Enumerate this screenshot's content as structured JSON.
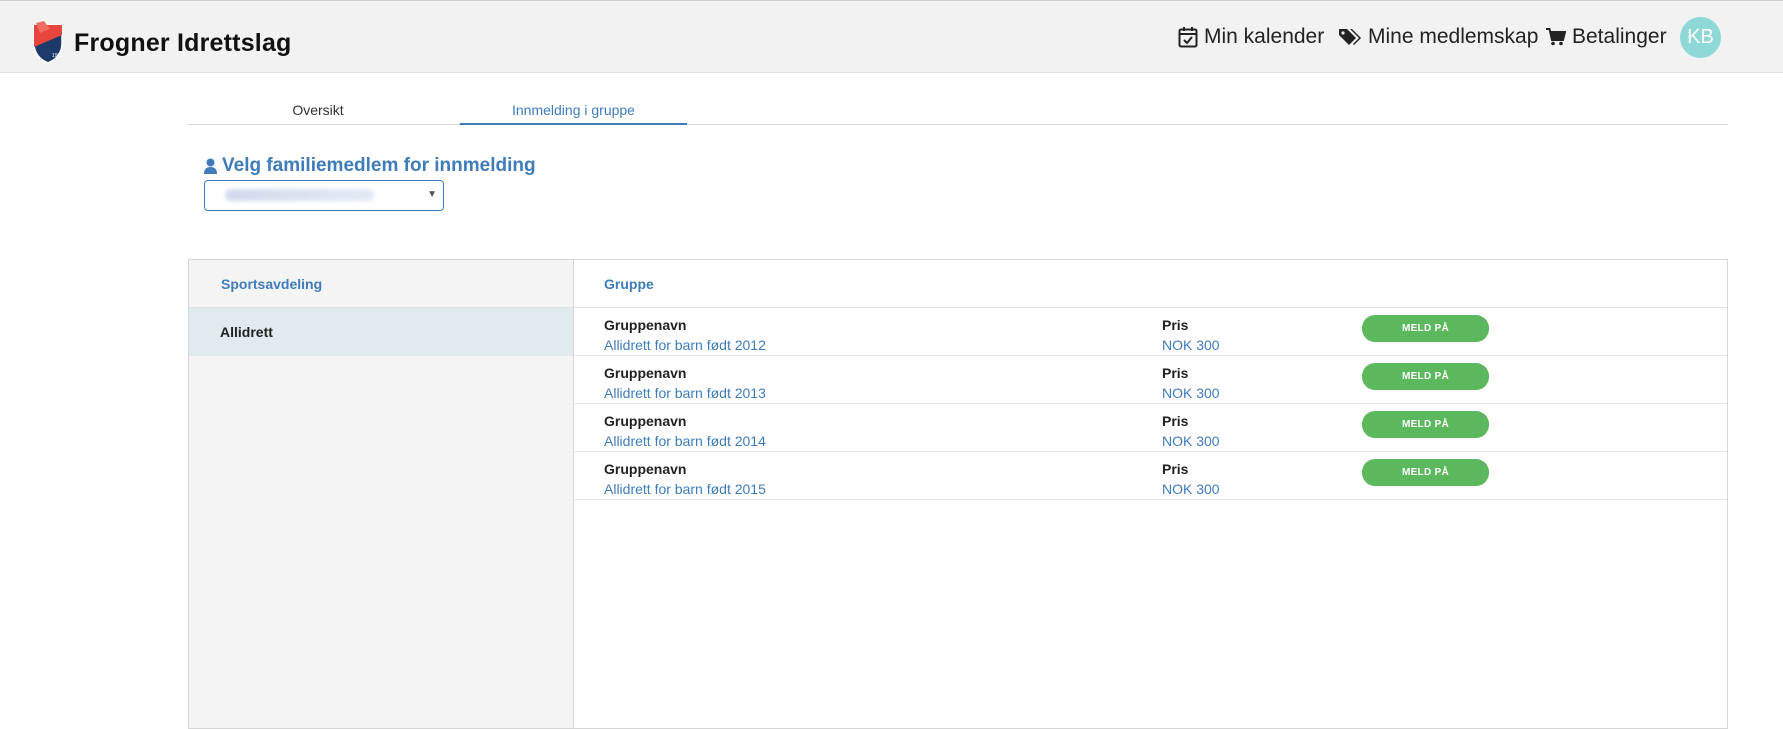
{
  "header": {
    "brand_name": "Frogner Idrettslag",
    "logo_icon": "club-crest",
    "nav": {
      "calendar_label": "Min kalender",
      "memberships_label": "Mine medlemskap",
      "payments_label": "Betalinger"
    },
    "avatar_initials": "KB",
    "avatar_color": "#8fd8d8"
  },
  "tabs": [
    {
      "label": "Oversikt",
      "active": false
    },
    {
      "label": "Innmelding i gruppe",
      "active": true
    }
  ],
  "family": {
    "title": "Velg familiemedlem for innmelding",
    "icon": "user-icon",
    "selected_value_hidden": true
  },
  "sidebar": {
    "header": "Sportsavdeling",
    "items": [
      {
        "label": "Allidrett",
        "selected": true
      }
    ]
  },
  "groups": {
    "header": "Gruppe",
    "name_label": "Gruppenavn",
    "price_label": "Pris",
    "button_label": "MELD PÅ",
    "rows": [
      {
        "name": "Allidrett for barn født 2012",
        "price": "NOK 300"
      },
      {
        "name": "Allidrett for barn født 2013",
        "price": "NOK 300"
      },
      {
        "name": "Allidrett for barn født 2014",
        "price": "NOK 300"
      },
      {
        "name": "Allidrett for barn født 2015",
        "price": "NOK 300"
      }
    ]
  },
  "colors": {
    "accent": "#3f7cba",
    "button": "#5cb85c",
    "topbar_bg": "#f2f2f2"
  }
}
